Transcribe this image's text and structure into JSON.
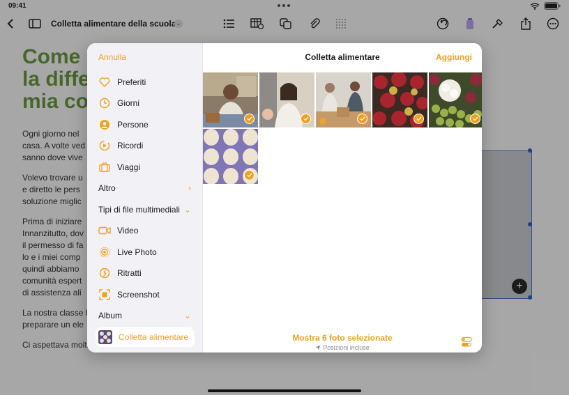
{
  "status_bar": {
    "time": "09:41"
  },
  "document": {
    "title": "Colletta alimentare della scuola",
    "heading_lines": [
      "Come",
      "la diffe",
      "mia co"
    ],
    "paragraphs": [
      "Ogni giorno nel\ncasa. A volte ved\nsanno dove vive",
      "Volevo trovare u\ne diretto le pers\nsoluzione miglic",
      "Prima di iniziare\nInnanzitutto, dov\nil permesso di fa\nlo e i miei comp\nquindi abbiamo\ncomunità espert\ndi assistenza ali",
      "La nostra classe h\npreparare un ele",
      "Ci aspettava molto lavoro, ma non vedevamo l'ora di aiutare!"
    ]
  },
  "picker": {
    "cancel_label": "Annulla",
    "title": "Colletta alimentare",
    "add_label": "Aggiungi",
    "sidebar": {
      "library_items": [
        {
          "label": "Preferiti",
          "icon": "heart-icon"
        },
        {
          "label": "Giorni",
          "icon": "clock-icon"
        },
        {
          "label": "Persone",
          "icon": "person-circle-icon"
        },
        {
          "label": "Ricordi",
          "icon": "memories-icon"
        },
        {
          "label": "Viaggi",
          "icon": "suitcase-icon"
        }
      ],
      "more_label": "Altro",
      "media_types_label": "Tipi di file multimediali",
      "media_items": [
        {
          "label": "Video",
          "icon": "video-icon"
        },
        {
          "label": "Live Photo",
          "icon": "live-photo-icon"
        },
        {
          "label": "Ritratti",
          "icon": "portrait-icon"
        },
        {
          "label": "Screenshot",
          "icon": "screenshot-icon"
        }
      ],
      "album_label": "Album",
      "selected_album": "Colletta alimentare"
    },
    "photos": [
      {
        "subject": "volunteer-woman",
        "selected": true
      },
      {
        "subject": "smiling-girl",
        "selected": true
      },
      {
        "subject": "volunteers-food-bank",
        "selected": true
      },
      {
        "subject": "pomegranates",
        "selected": true
      },
      {
        "subject": "cauliflower-grapes",
        "selected": true
      },
      {
        "subject": "eggs-in-tray",
        "selected": true
      }
    ],
    "footer_main": "Mostra 6 foto selezionate",
    "footer_sub": "Posizioni incluse"
  },
  "colors": {
    "accent": "#f0a020",
    "heading_green": "#6b9a3f",
    "dim_overlay": "rgba(0,0,0,0.33)"
  }
}
